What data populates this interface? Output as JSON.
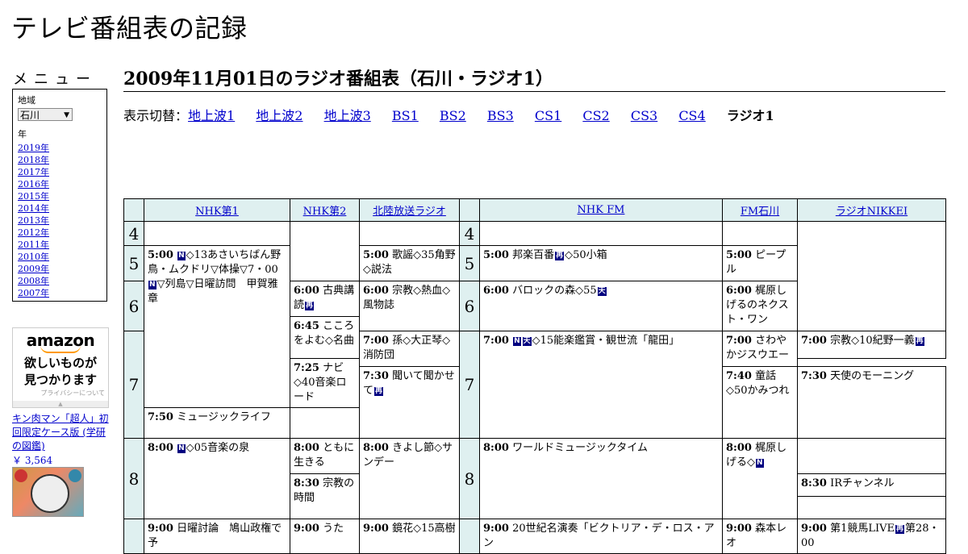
{
  "site_title": "テレビ番組表の記録",
  "menu": {
    "label": "メニュー",
    "region_label": "地域",
    "region_value": "石川",
    "year_label": "年",
    "years": [
      "2019年",
      "2018年",
      "2017年",
      "2016年",
      "2015年",
      "2014年",
      "2013年",
      "2012年",
      "2011年",
      "2010年",
      "2009年",
      "2008年",
      "2007年"
    ]
  },
  "ad": {
    "logo": "amazon",
    "message_line1": "欲しいものが",
    "message_line2": "見つかります",
    "privacy": "プライバシーについて"
  },
  "book": {
    "title": "キン肉マン「超人」初回限定ケース版 (学研の図鑑)",
    "price": "￥ 3,564"
  },
  "heading": "2009年11月01日のラジオ番組表（石川・ラジオ1）",
  "switcher": {
    "label": "表示切替：",
    "links": [
      "地上波1",
      "地上波2",
      "地上波3",
      "BS1",
      "BS2",
      "BS3",
      "CS1",
      "CS2",
      "CS3",
      "CS4"
    ],
    "current": "ラジオ1"
  },
  "channels": [
    "NHK第1",
    "NHK第2",
    "北陸放送ラジオ",
    "NHK FM",
    "FM石川",
    "ラジオNIKKEI"
  ],
  "hours": [
    "4",
    "5",
    "6",
    "7",
    "8"
  ],
  "programs": {
    "nhk1_500": {
      "time": "5:00",
      "a": "◇13あさいちばん野鳥・ムクドリ▽体操▽7・00",
      "b": "▽列島▽日曜訪問　甲賀雅章"
    },
    "nhk1_800": {
      "time": "8:00",
      "a": "◇05音楽の泉"
    },
    "nhk1_900": {
      "time": "9:00",
      "a": "日曜討論　鳩山政権で予"
    },
    "nhk2_600": {
      "time": "6:00",
      "a": "古典講読"
    },
    "nhk2_645": {
      "time": "6:45",
      "a": "こころをよむ◇名曲"
    },
    "nhk2_730": {
      "time": "7:30",
      "a": "聞いて聞かせて"
    },
    "nhk2_800": {
      "time": "8:00",
      "a": "ともに生きる"
    },
    "nhk2_830": {
      "time": "8:30",
      "a": "宗教の時間"
    },
    "nhk2_900": {
      "time": "9:00",
      "a": "うた"
    },
    "mro_500": {
      "time": "5:00",
      "a": "歌謡◇35角野◇説法"
    },
    "mro_600": {
      "time": "6:00",
      "a": "宗教◇熱血◇風物誌"
    },
    "mro_700": {
      "time": "7:00",
      "a": "孫◇大正琴◇消防団"
    },
    "mro_740": {
      "time": "7:40",
      "a": "童話◇50かみつれ"
    },
    "mro_800": {
      "time": "8:00",
      "a": "きよし節◇サンデー"
    },
    "mro_900": {
      "time": "9:00",
      "a": "鏡花◇15高樹"
    },
    "fm_500": {
      "time": "5:00",
      "a": "邦楽百番",
      "b": "◇50小箱"
    },
    "fm_600": {
      "time": "6:00",
      "a": "バロックの森◇55"
    },
    "fm_700": {
      "time": "7:00",
      "a": "◇15能楽鑑賞・観世流「龍田」"
    },
    "fm_800": {
      "time": "8:00",
      "a": "ワールドミュージックタイム"
    },
    "fm_900": {
      "time": "9:00",
      "a": "20世紀名演奏「ビクトリア・デ・ロス・アン"
    },
    "hfm_500": {
      "time": "5:00",
      "a": "ピープル"
    },
    "hfm_600": {
      "time": "6:00",
      "a": "梶原しげるのネクスト・ワン"
    },
    "hfm_700": {
      "time": "7:00",
      "a": "さわやかジスウエー"
    },
    "hfm_730": {
      "time": "7:30",
      "a": "天使のモーニング"
    },
    "hfm_800": {
      "time": "8:00",
      "a": "梶原しげる◇"
    },
    "hfm_900": {
      "time": "9:00",
      "a": "森本レオ"
    },
    "nik_700": {
      "time": "7:00",
      "a": "宗教◇10紀野一義"
    },
    "nik_725": {
      "time": "7:25",
      "a": "ナビ◇40音楽ロード"
    },
    "nik_750": {
      "time": "7:50",
      "a": "ミュージックライフ"
    },
    "nik_830": {
      "time": "8:30",
      "a": "IRチャンネル"
    },
    "nik_900": {
      "time": "9:00",
      "a": "第1競馬LIVE",
      "b": "第28・00"
    }
  },
  "symbols": {
    "news": "N",
    "rebroadcast": "再",
    "stereo": "天"
  }
}
